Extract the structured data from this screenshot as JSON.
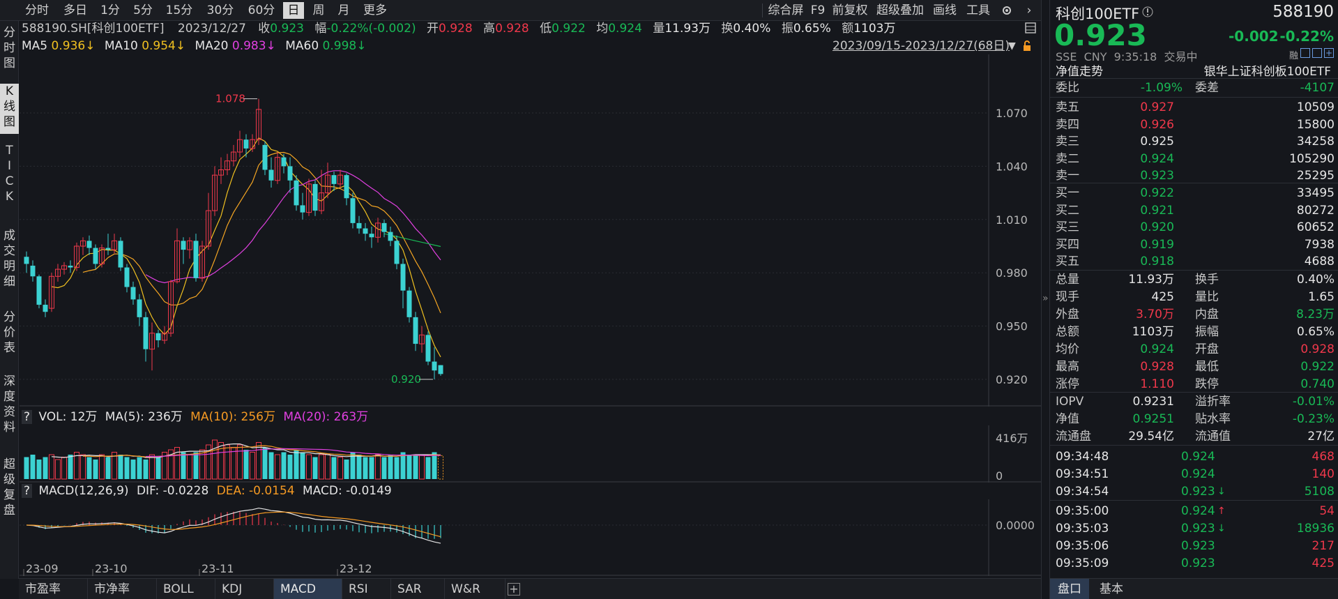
{
  "toolbar": {
    "periods": [
      "分时",
      "多日",
      "1分",
      "5分",
      "15分",
      "30分",
      "60分",
      "日",
      "周",
      "月",
      "更多"
    ],
    "active_period": "日",
    "right_tools": [
      "综合屏",
      "F9",
      "前复权",
      "超级叠加",
      "画线",
      "工具"
    ]
  },
  "left_tabs": [
    "分时图",
    "K线图",
    "TICK",
    "成交明细",
    "分价表",
    "深度资料",
    "超级复盘"
  ],
  "active_left_tab": "K线图",
  "quote_line": {
    "code": "588190.SH[科创100ETF]",
    "date": "2023/12/27",
    "close_label": "收",
    "close": "0.923",
    "change_label": "幅",
    "change": "-0.22%(-0.002)",
    "open_label": "开",
    "open": "0.928",
    "high_label": "高",
    "high": "0.928",
    "low_label": "低",
    "low": "0.922",
    "avg_label": "均",
    "avg": "0.924",
    "volume_label": "量",
    "volume": "11.93万",
    "turnover_label": "换",
    "turnover": "0.40%",
    "amplitude_label": "振",
    "amplitude": "0.65%",
    "amount_label": "额",
    "amount": "1103万"
  },
  "ma_line": {
    "ma5_label": "MA5",
    "ma5": "0.936↓",
    "ma10_label": "MA10",
    "ma10": "0.954↓",
    "ma20_label": "MA20",
    "ma20": "0.983↓",
    "ma60_label": "MA60",
    "ma60": "0.998↓",
    "range": "2023/09/15-2023/12/27(68日)"
  },
  "volume_line": {
    "q": "?",
    "vol": "VOL: 12万",
    "ma5": "MA(5): 236万",
    "ma10": "MA(10): 256万",
    "ma20": "MA(20): 263万"
  },
  "macd_line": {
    "q": "?",
    "title": "MACD(12,26,9)",
    "dif": "DIF: -0.0228",
    "dea": "DEA: -0.0154",
    "macd": "MACD: -0.0149"
  },
  "chart_data": {
    "type": "candlestick",
    "price_axis": [
      "1.070",
      "1.040",
      "1.010",
      "0.980",
      "0.950",
      "0.920"
    ],
    "price_ticks": [
      1.07,
      1.04,
      1.01,
      0.98,
      0.95,
      0.92
    ],
    "high_marker": "1.078",
    "low_marker": "0.920",
    "volume_axis": [
      "416万",
      "0"
    ],
    "macd_axis": [
      "0.0000"
    ],
    "date_axis": [
      "23-09",
      "23-10",
      "23-11",
      "23-12"
    ],
    "candles": [
      [
        0.989,
        0.985,
        0.992,
        0.98
      ],
      [
        0.984,
        0.978,
        0.987,
        0.975
      ],
      [
        0.978,
        0.962,
        0.979,
        0.96
      ],
      [
        0.962,
        0.958,
        0.965,
        0.955
      ],
      [
        0.96,
        0.978,
        0.98,
        0.958
      ],
      [
        0.978,
        0.982,
        0.985,
        0.975
      ],
      [
        0.982,
        0.984,
        0.986,
        0.979
      ],
      [
        0.984,
        0.983,
        0.987,
        0.98
      ],
      [
        0.983,
        0.995,
        0.997,
        0.981
      ],
      [
        0.995,
        0.998,
        1.0,
        0.99
      ],
      [
        0.998,
        0.994,
        1.001,
        0.99
      ],
      [
        0.994,
        0.985,
        0.996,
        0.982
      ],
      [
        0.985,
        0.994,
        0.996,
        0.983
      ],
      [
        0.994,
        0.993,
        1.002,
        0.99
      ],
      [
        0.993,
        0.998,
        1.002,
        0.991
      ],
      [
        0.998,
        0.983,
        1.0,
        0.981
      ],
      [
        0.983,
        0.972,
        0.985,
        0.969
      ],
      [
        0.972,
        0.965,
        0.975,
        0.962
      ],
      [
        0.965,
        0.955,
        0.968,
        0.95
      ],
      [
        0.955,
        0.937,
        0.958,
        0.93
      ],
      [
        0.937,
        0.946,
        0.952,
        0.925
      ],
      [
        0.946,
        0.942,
        0.948,
        0.938
      ],
      [
        0.942,
        0.946,
        0.95,
        0.94
      ],
      [
        0.946,
        0.975,
        0.976,
        0.944
      ],
      [
        0.975,
        0.998,
        1.005,
        0.974
      ],
      [
        0.998,
        0.993,
        1.0,
        0.985
      ],
      [
        0.993,
        0.998,
        1.0,
        0.988
      ],
      [
        0.998,
        0.977,
        1.002,
        0.975
      ],
      [
        0.977,
        0.995,
        0.998,
        0.975
      ],
      [
        0.995,
        1.015,
        1.025,
        0.993
      ],
      [
        1.015,
        1.035,
        1.04,
        1.012
      ],
      [
        1.035,
        1.038,
        1.045,
        1.03
      ],
      [
        1.038,
        1.043,
        1.047,
        1.035
      ],
      [
        1.043,
        1.048,
        1.052,
        1.04
      ],
      [
        1.048,
        1.055,
        1.06,
        1.045
      ],
      [
        1.055,
        1.05,
        1.058,
        1.045
      ],
      [
        1.05,
        1.055,
        1.058,
        1.048
      ],
      [
        1.055,
        1.072,
        1.078,
        1.052
      ],
      [
        1.052,
        1.038,
        1.054,
        1.035
      ],
      [
        1.038,
        1.032,
        1.045,
        1.028
      ],
      [
        1.032,
        1.045,
        1.048,
        1.03
      ],
      [
        1.045,
        1.04,
        1.047,
        1.036
      ],
      [
        1.04,
        1.032,
        1.045,
        1.025
      ],
      [
        1.032,
        1.018,
        1.035,
        1.015
      ],
      [
        1.018,
        1.014,
        1.025,
        1.01
      ],
      [
        1.014,
        1.03,
        1.033,
        1.012
      ],
      [
        1.03,
        1.015,
        1.032,
        1.012
      ],
      [
        1.015,
        1.025,
        1.038,
        1.013
      ],
      [
        1.025,
        1.035,
        1.042,
        1.022
      ],
      [
        1.035,
        1.03,
        1.037,
        1.026
      ],
      [
        1.03,
        1.035,
        1.038,
        1.028
      ],
      [
        1.035,
        1.022,
        1.036,
        1.018
      ],
      [
        1.022,
        1.008,
        1.025,
        1.005
      ],
      [
        1.008,
        1.005,
        1.012,
        1.002
      ],
      [
        1.005,
        1.002,
        1.008,
        0.998
      ],
      [
        1.002,
        1.0,
        1.006,
        0.994
      ],
      [
        1.0,
        1.008,
        1.011,
        0.997
      ],
      [
        1.008,
        1.003,
        1.01,
        1.0
      ],
      [
        1.003,
        0.998,
        1.006,
        0.995
      ],
      [
        0.998,
        0.985,
        1.001,
        0.982
      ],
      [
        0.985,
        0.97,
        0.988,
        0.96
      ],
      [
        0.97,
        0.955,
        0.972,
        0.952
      ],
      [
        0.955,
        0.94,
        0.958,
        0.936
      ],
      [
        0.94,
        0.945,
        0.95,
        0.935
      ],
      [
        0.945,
        0.93,
        0.947,
        0.928
      ],
      [
        0.93,
        0.925,
        0.938,
        0.92
      ],
      [
        0.928,
        0.923,
        0.928,
        0.922
      ]
    ],
    "volume_ratio": [
      0.45,
      0.5,
      0.4,
      0.45,
      0.5,
      0.4,
      0.45,
      0.5,
      0.55,
      0.5,
      0.45,
      0.4,
      0.5,
      0.45,
      0.55,
      0.5,
      0.45,
      0.4,
      0.45,
      0.4,
      0.5,
      0.45,
      0.55,
      0.6,
      0.65,
      0.55,
      0.5,
      0.55,
      0.6,
      0.7,
      0.8,
      0.75,
      0.7,
      0.65,
      0.7,
      0.6,
      0.55,
      0.75,
      0.65,
      0.55,
      0.5,
      0.55,
      0.5,
      0.6,
      0.55,
      0.5,
      0.45,
      0.5,
      0.5,
      0.45,
      0.45,
      0.4,
      0.55,
      0.5,
      0.45,
      0.45,
      0.5,
      0.45,
      0.5,
      0.45,
      0.55,
      0.5,
      0.5,
      0.5,
      0.45,
      0.55,
      0.48
    ],
    "series": [
      {
        "name": "MA5",
        "color": "#f0c020"
      },
      {
        "name": "MA10",
        "color": "#f5a623"
      },
      {
        "name": "MA20",
        "color": "#e040e0"
      },
      {
        "name": "MA60",
        "color": "#19b956"
      }
    ]
  },
  "right": {
    "name": "科创100ETF",
    "code": "588190",
    "price": "0.923",
    "change": "-0.002",
    "change_pct": "-0.22%",
    "meta": "SSE  CNY  9:35:18  交易中",
    "nav_trend": "净值走势",
    "fund_name": "银华上证科创板100ETF",
    "weibi_label": "委比",
    "weibi": "-1.09%",
    "weicha_label": "委差",
    "weicha": "-4107",
    "sells": [
      {
        "label": "卖五",
        "price": "0.927",
        "vol": "10509"
      },
      {
        "label": "卖四",
        "price": "0.926",
        "vol": "15800"
      },
      {
        "label": "卖三",
        "price": "0.925",
        "vol": "34258"
      },
      {
        "label": "卖二",
        "price": "0.924",
        "vol": "105290"
      },
      {
        "label": "卖一",
        "price": "0.923",
        "vol": "25295"
      }
    ],
    "buys": [
      {
        "label": "买一",
        "price": "0.922",
        "vol": "33495"
      },
      {
        "label": "买二",
        "price": "0.921",
        "vol": "80272"
      },
      {
        "label": "买三",
        "price": "0.920",
        "vol": "60652"
      },
      {
        "label": "买四",
        "price": "0.919",
        "vol": "7938"
      },
      {
        "label": "买五",
        "price": "0.918",
        "vol": "4688"
      }
    ],
    "stats": [
      {
        "l1": "总量",
        "v1": "11.93万",
        "l2": "换手",
        "v2": "0.40%",
        "c1": "white",
        "c2": "white"
      },
      {
        "l1": "现手",
        "v1": "425",
        "l2": "量比",
        "v2": "1.65",
        "c1": "white",
        "c2": "white"
      },
      {
        "l1": "外盘",
        "v1": "3.70万",
        "l2": "内盘",
        "v2": "8.23万",
        "c1": "red",
        "c2": "green"
      },
      {
        "l1": "总额",
        "v1": "1103万",
        "l2": "振幅",
        "v2": "0.65%",
        "c1": "white",
        "c2": "white"
      },
      {
        "l1": "均价",
        "v1": "0.924",
        "l2": "开盘",
        "v2": "0.928",
        "c1": "green",
        "c2": "red"
      },
      {
        "l1": "最高",
        "v1": "0.928",
        "l2": "最低",
        "v2": "0.922",
        "c1": "red",
        "c2": "green"
      },
      {
        "l1": "涨停",
        "v1": "1.110",
        "l2": "跌停",
        "v2": "0.740",
        "c1": "red",
        "c2": "green"
      }
    ],
    "stats2": [
      {
        "l1": "IOPV",
        "v1": "0.9231",
        "l2": "溢折率",
        "v2": "-0.01%",
        "c1": "white",
        "c2": "green"
      },
      {
        "l1": "净值",
        "v1": "0.9251",
        "l2": "贴水率",
        "v2": "-0.23%",
        "c1": "green",
        "c2": "green"
      },
      {
        "l1": "流通盘",
        "v1": "29.54亿",
        "l2": "流通值",
        "v2": "27亿",
        "c1": "white",
        "c2": "white"
      }
    ],
    "ticks": [
      {
        "time": "09:34:48",
        "price": "0.924",
        "arrow": "",
        "vol": "468",
        "vc": "red"
      },
      {
        "time": "09:34:51",
        "price": "0.924",
        "arrow": "",
        "vol": "140",
        "vc": "red"
      },
      {
        "time": "09:34:54",
        "price": "0.923",
        "arrow": "↓",
        "vol": "5108",
        "vc": "green"
      },
      {
        "time": "09:35:00",
        "price": "0.924",
        "arrow": "↑",
        "vol": "54",
        "vc": "red"
      },
      {
        "time": "09:35:03",
        "price": "0.923",
        "arrow": "↓",
        "vol": "18936",
        "vc": "green"
      },
      {
        "time": "09:35:06",
        "price": "0.923",
        "arrow": "",
        "vol": "217",
        "vc": "red"
      },
      {
        "time": "09:35:09",
        "price": "0.923",
        "arrow": "",
        "vol": "425",
        "vc": "red"
      }
    ],
    "bottom_tabs": [
      "盘口",
      "基本"
    ]
  },
  "bottom_tabs": [
    "市盈率",
    "市净率",
    "BOLL",
    "KDJ",
    "MACD",
    "RSI",
    "SAR",
    "W&R"
  ],
  "active_bottom_tab": "MACD"
}
